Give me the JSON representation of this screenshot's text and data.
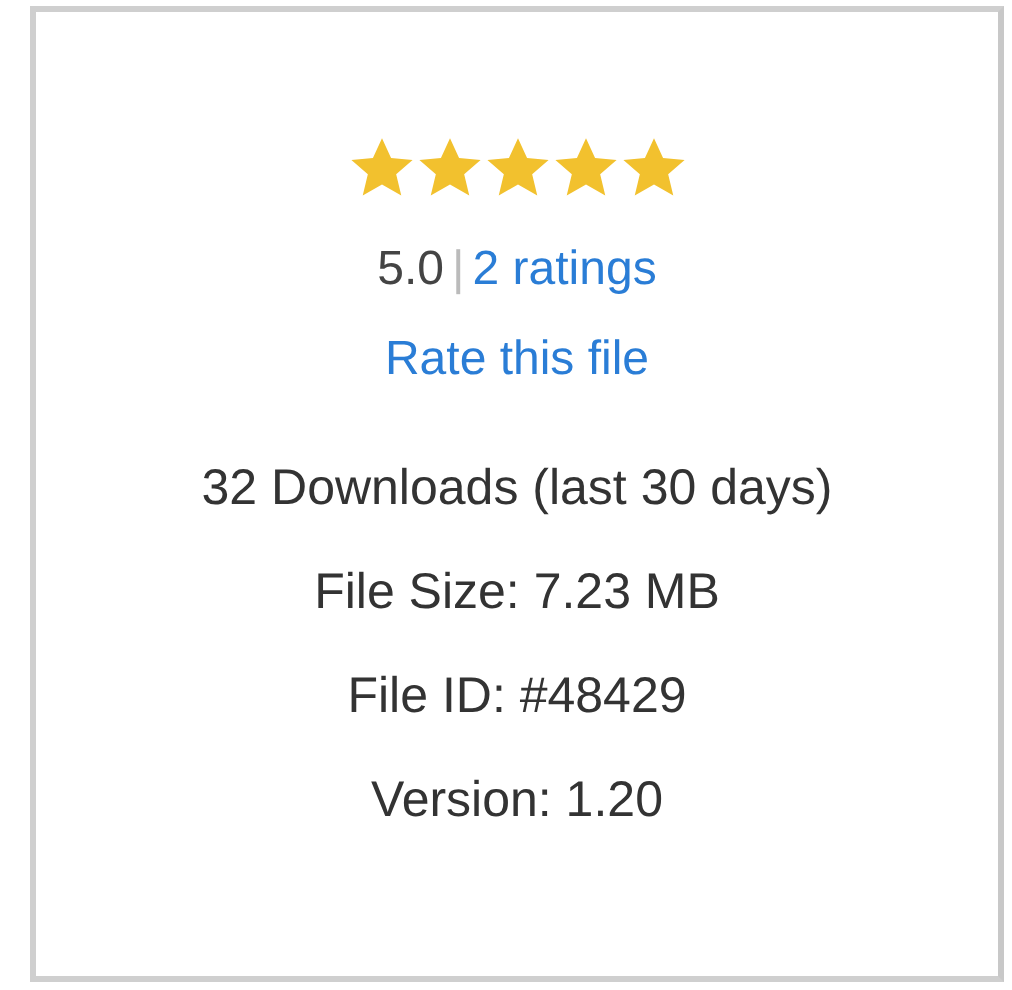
{
  "rating": {
    "stars": 5,
    "score": "5.0",
    "separator": "|",
    "ratings_link": "2 ratings",
    "rate_link": "Rate this file"
  },
  "stats": [
    "32 Downloads (last 30 days)",
    "File Size: 7.23 MB",
    "File ID: #48429",
    "Version: 1.20"
  ]
}
